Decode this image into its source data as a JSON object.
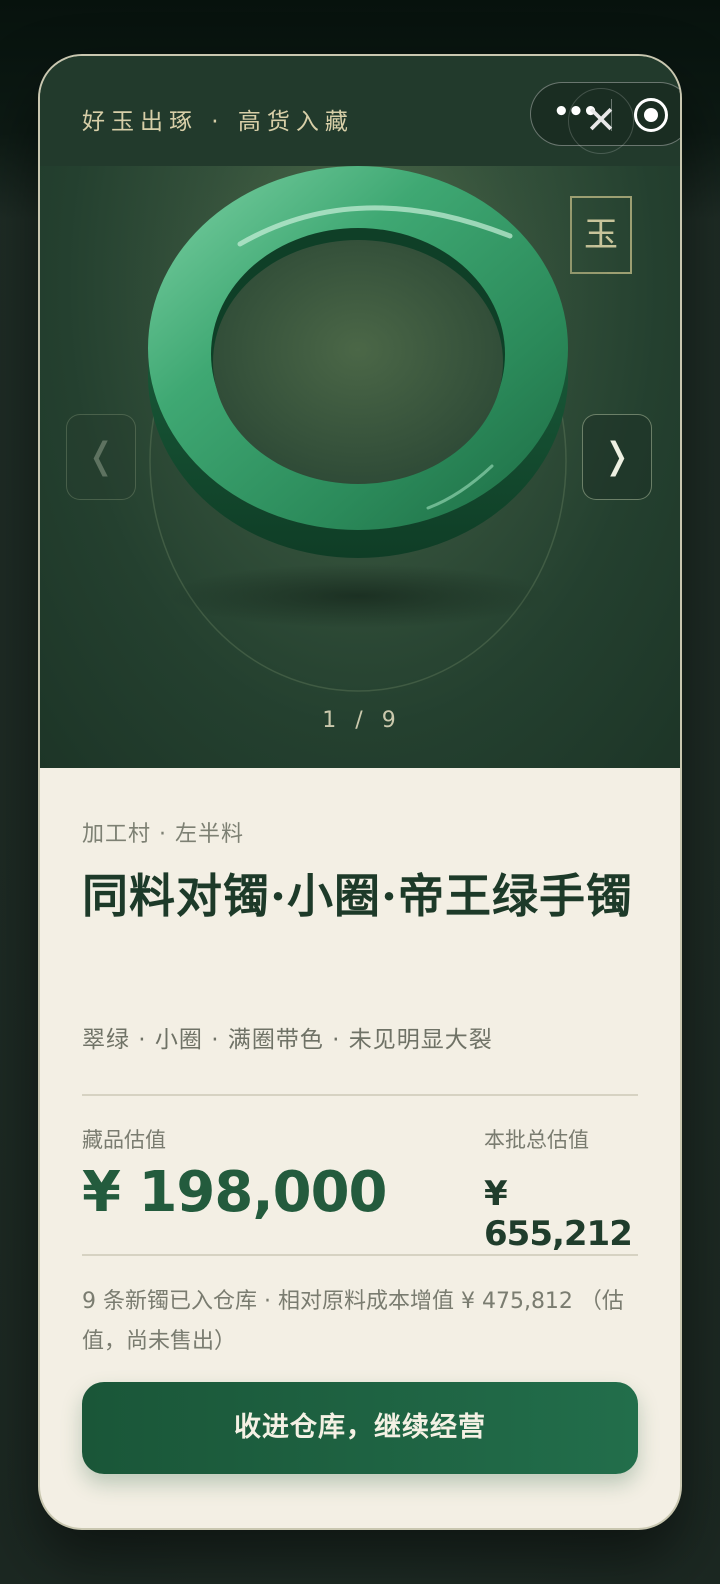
{
  "hero": {
    "tagline": "好玉出琢 · 高货入藏",
    "seal_char": "玉",
    "prev_icon": "chevron-left-icon",
    "next_icon": "chevron-right-icon",
    "prev_glyph": "❬",
    "next_glyph": "❭",
    "pager": "1 / 9",
    "jade_color": "#3fa873"
  },
  "miniprogram": {
    "more_glyph": "•••",
    "close_glyph": "✕"
  },
  "item": {
    "origin": "加工村 · 左半料",
    "title": "同料对镯·小圈·帝王绿手镯",
    "attributes": "翠绿 · 小圈 · 满圈带色 · 未见明显大裂"
  },
  "valuation": {
    "item_label": "藏品估值",
    "item_value": "¥ 198,000",
    "batch_label": "本批总估值",
    "batch_value": "¥ 655,212"
  },
  "note": "9 条新镯已入仓库 · 相对原料成本增值 ¥ 475,812 （估值，尚未售出）",
  "cta": {
    "label": "收进仓库，继续经营"
  },
  "colors": {
    "accent": "#235b3d",
    "card_bg": "#f3efe4",
    "hero_bg": "#24402f"
  }
}
